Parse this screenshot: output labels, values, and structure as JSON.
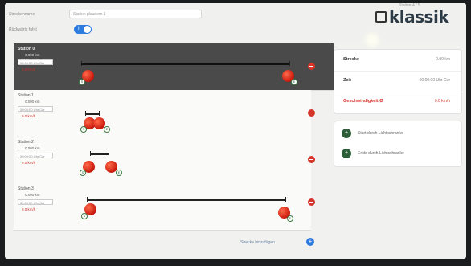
{
  "header": {
    "name_label": "Streckenname",
    "name_value": "Station plaudern 1",
    "toggle_label": "Rückwärts fahrt",
    "toggle_mark": "I",
    "logo": "klassik",
    "top_right_text": "Station 4 / 5"
  },
  "stations": [
    {
      "name": "Station 0",
      "distance": "0.000 km",
      "time": "00:00:00 Uhr Cur",
      "speed": "0.0 km/h",
      "active": true
    },
    {
      "name": "Station 1",
      "distance": "0.000 km",
      "time": "00:00:00 Uhr Cur",
      "speed": "0.0 km/h",
      "active": false
    },
    {
      "name": "Station 2",
      "distance": "0.000 km",
      "time": "00:00:00 Uhr Cur",
      "speed": "0.0 km/h",
      "active": false
    },
    {
      "name": "Station 3",
      "distance": "0.000 km",
      "time": "00:00:00 Uhr Cur",
      "speed": "0.0 km/h",
      "active": false
    }
  ],
  "summary": {
    "distance_label": "Strecke",
    "distance_value": "0.00 km",
    "time_label": "Zeit",
    "time_value": "00:00:00 Uhr Cur",
    "speed_label": "Geschwindigkeit Ø",
    "speed_value": "0.0 km/h"
  },
  "actions": [
    {
      "icon": "+",
      "label": "Start durch Lichtschranke"
    },
    {
      "icon": "+",
      "label": "Ende durch Lichtschranke"
    }
  ],
  "footer": {
    "add_label": "Strecke hinzufügen",
    "add_icon": "+"
  },
  "colors": {
    "accent": "#2e7be0",
    "warning": "#d9342a",
    "active_station_bg": "#4a4a4a",
    "action_icon": "#2e5d3a"
  }
}
